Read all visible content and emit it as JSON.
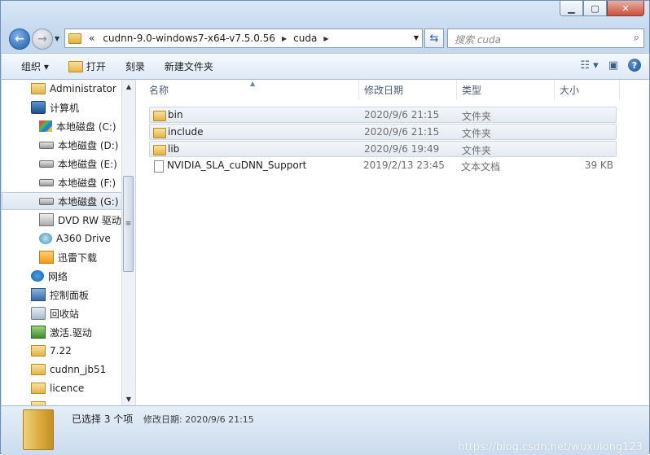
{
  "address": {
    "overflow": "«",
    "crumbs": [
      "cudnn-9.0-windows7-x64-v7.5.0.56",
      "cuda"
    ]
  },
  "search": {
    "placeholder": "搜索 cuda"
  },
  "toolbar": {
    "organize": "组织 ▾",
    "open": "打开",
    "burn": "刻录",
    "new_folder": "新建文件夹"
  },
  "nav": {
    "items": [
      {
        "label": "Administrator",
        "icon": "user-folder-icon"
      },
      {
        "label": "计算机",
        "icon": "computer-icon"
      },
      {
        "label": "本地磁盘 (C:)",
        "icon": "windows-drive-icon"
      },
      {
        "label": "本地磁盘 (D:)",
        "icon": "drive-icon"
      },
      {
        "label": "本地磁盘 (E:)",
        "icon": "drive-icon"
      },
      {
        "label": "本地磁盘 (F:)",
        "icon": "drive-icon"
      },
      {
        "label": "本地磁盘 (G:)",
        "icon": "drive-icon",
        "selected": true
      },
      {
        "label": "DVD RW 驱动",
        "icon": "dvd-icon"
      },
      {
        "label": "A360 Drive",
        "icon": "cloud-drive-icon"
      },
      {
        "label": "迅雷下载",
        "icon": "thunder-folder-icon"
      },
      {
        "label": "网络",
        "icon": "network-icon"
      },
      {
        "label": "控制面板",
        "icon": "control-panel-icon"
      },
      {
        "label": "回收站",
        "icon": "recycle-bin-icon"
      },
      {
        "label": "激活.驱动",
        "icon": "activation-icon"
      },
      {
        "label": "7.22",
        "icon": "folder-icon"
      },
      {
        "label": "cudnn_jb51",
        "icon": "folder-icon"
      },
      {
        "label": "licence",
        "icon": "folder-icon"
      }
    ]
  },
  "columns": {
    "name": "名称",
    "date": "修改日期",
    "type": "类型",
    "size": "大小"
  },
  "files": [
    {
      "name": "bin",
      "date": "2020/9/6 21:15",
      "type": "文件夹",
      "size": "",
      "icon": "folder-icon",
      "selected": true
    },
    {
      "name": "include",
      "date": "2020/9/6 21:15",
      "type": "文件夹",
      "size": "",
      "icon": "folder-icon",
      "selected": true
    },
    {
      "name": "lib",
      "date": "2020/9/6 19:49",
      "type": "文件夹",
      "size": "",
      "icon": "folder-icon",
      "selected": true
    },
    {
      "name": "NVIDIA_SLA_cuDNN_Support",
      "date": "2019/2/13 23:45",
      "type": "文本文档",
      "size": "39 KB",
      "icon": "text-document-icon",
      "selected": false
    }
  ],
  "status": {
    "selected": "已选择 3 个项",
    "modified": "修改日期: 2020/9/6 21:15"
  },
  "watermark": "https://blog.csdn.net/wuxulong123"
}
